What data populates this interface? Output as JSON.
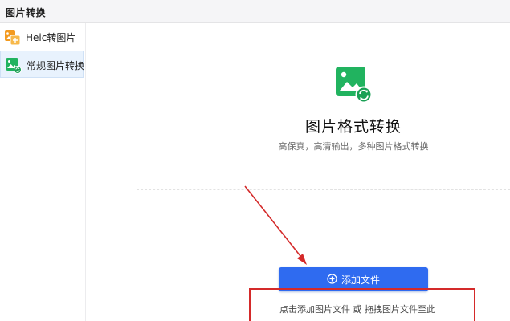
{
  "window": {
    "title": "图片转换"
  },
  "sidebar": {
    "items": [
      {
        "label": "Heic转图片",
        "icon": "heic-image-icon",
        "active": false
      },
      {
        "label": "常规图片转换",
        "icon": "image-convert-icon",
        "active": true
      }
    ]
  },
  "main": {
    "icon": "image-convert-icon",
    "title": "图片格式转换",
    "subtitle": "高保真，高清输出，多种图片格式转换",
    "add_button_label": "添加文件",
    "drop_hint": "点击添加图片文件 或 拖拽图片文件至此"
  },
  "colors": {
    "accent": "#2f6bf0",
    "icon_green": "#21b35f",
    "icon_orange": "#f39a1f",
    "annotation_red": "#d42a2a",
    "active_bg": "#e8f2fd"
  }
}
